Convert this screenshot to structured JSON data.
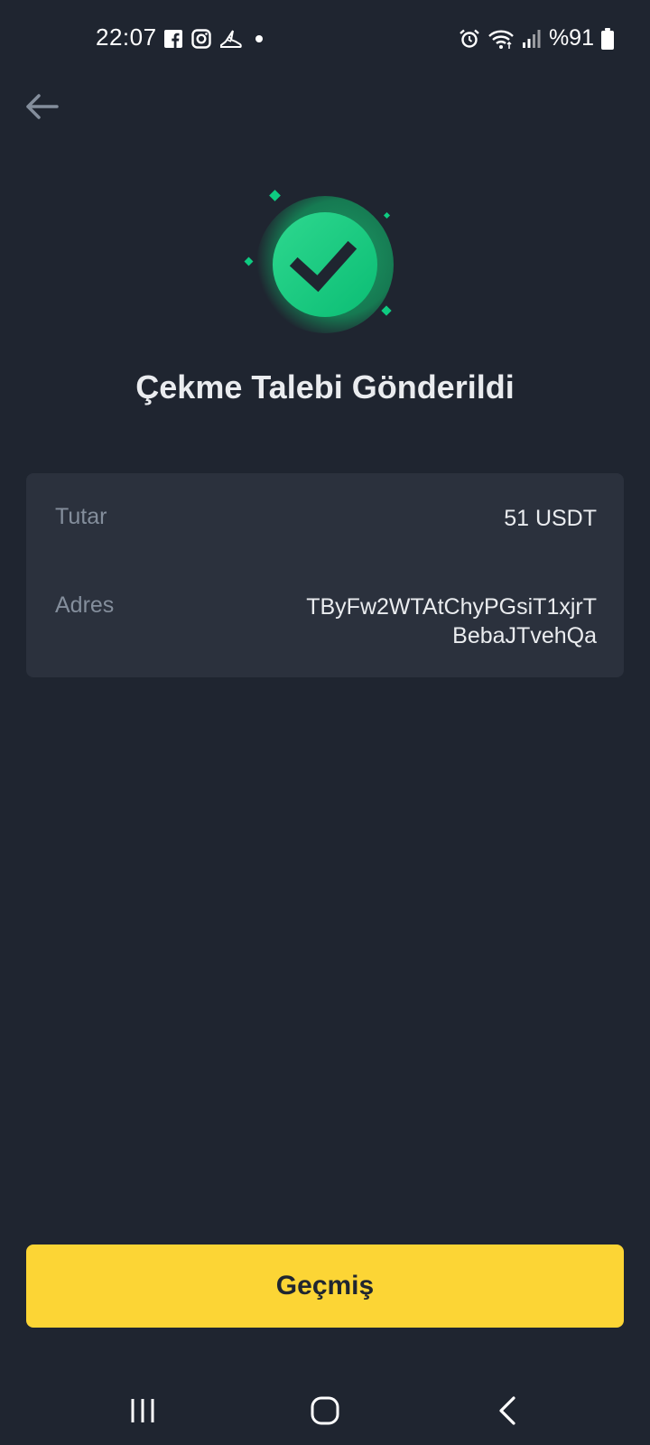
{
  "status_bar": {
    "time": "22:07",
    "battery_percent": "%91",
    "left_icons": [
      "facebook-icon",
      "instagram-icon",
      "shoe-app-icon",
      "notification-dot-icon"
    ],
    "right_icons": [
      "alarm-icon",
      "wifi-icon",
      "signal-icon",
      "battery-icon"
    ]
  },
  "header": {
    "back_icon": "arrow-left-icon"
  },
  "success": {
    "icon": "check-circle-icon",
    "title": "Çekme Talebi Gönderildi",
    "accent_color": "#0ecb81"
  },
  "details": {
    "amount_label": "Tutar",
    "amount_value": "51 USDT",
    "address_label": "Adres",
    "address_line1": "TByFw2WTAtChyPGsiT1xjrT",
    "address_line2": "BebaJTvehQa"
  },
  "actions": {
    "history_label": "Geçmiş",
    "button_color": "#fcd535"
  },
  "nav_bar": {
    "buttons": [
      "recents-icon",
      "home-icon",
      "back-icon"
    ]
  }
}
